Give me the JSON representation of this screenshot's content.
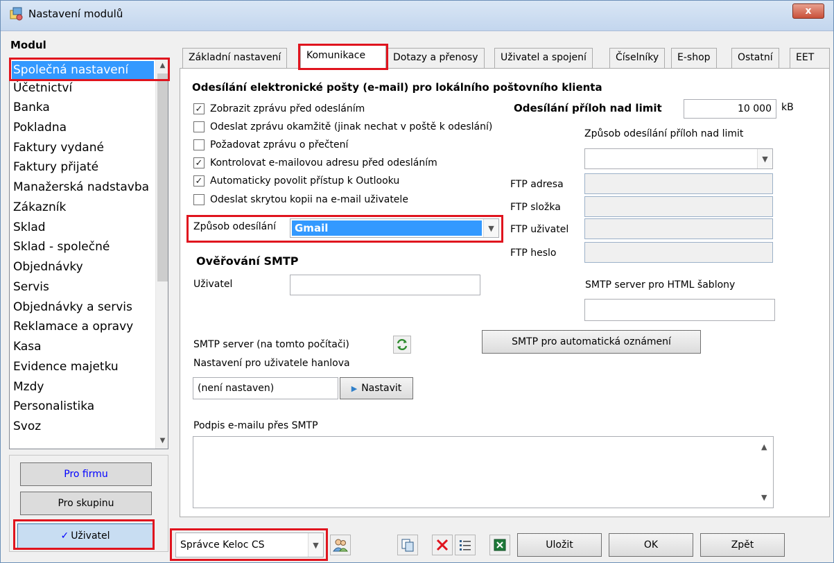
{
  "window": {
    "title": "Nastavení modulů",
    "close_label": "x"
  },
  "modules": {
    "header": "Modul",
    "items": [
      "Společná nastavení",
      "Účetnictví",
      "Banka",
      "Pokladna",
      "Faktury vydané",
      "Faktury přijaté",
      "Manažerská nadstavba",
      "Zákazník",
      "Sklad",
      "Sklad - společné",
      "Objednávky",
      "Servis",
      "Objednávky a servis",
      "Reklamace a opravy",
      "Kasa",
      "Evidence majetku",
      "Mzdy",
      "Personalistika",
      "Svoz"
    ],
    "selected_index": 0
  },
  "scope_buttons": {
    "company": "Pro firmu",
    "group": "Pro skupinu",
    "user": "Uživatel",
    "user_check": "✓"
  },
  "tabs": [
    "Základní nastavení",
    "Komunikace",
    "Dotazy a přenosy",
    "Uživatel a spojení",
    "Číselníky",
    "E-shop",
    "Ostatní",
    "EET"
  ],
  "active_tab": 1,
  "email": {
    "section_title": "Odesílání elektronické pošty (e-mail) pro lokálního poštovního klienta",
    "options": [
      {
        "label": "Zobrazit zprávu před odesláním",
        "checked": true
      },
      {
        "label": "Odeslat zprávu okamžitě (jinak nechat v poště k odeslání)",
        "checked": false
      },
      {
        "label": "Požadovat zprávu o přečtení",
        "checked": false
      },
      {
        "label": "Kontrolovat e-mailovou adresu před odesláním",
        "checked": true
      },
      {
        "label": "Automaticky povolit přístup k Outlooku",
        "checked": true
      },
      {
        "label": "Odeslat skrytou kopii na e-mail uživatele",
        "checked": false
      }
    ],
    "send_method_label": "Způsob odesílání",
    "send_method_value": "Gmail",
    "attachment_limit_label": "Odesílání příloh nad limit",
    "attachment_limit_value": "10 000",
    "attachment_limit_unit": "kB",
    "attachment_mode_label": "Způsob odesílání příloh nad limit",
    "attachment_mode_value": "",
    "ftp_address_label": "FTP adresa",
    "ftp_folder_label": "FTP složka",
    "ftp_user_label": "FTP uživatel",
    "ftp_password_label": "FTP heslo"
  },
  "smtp": {
    "auth_title": "Ověřování SMTP",
    "user_label": "Uživatel",
    "user_value": "",
    "html_server_label": "SMTP server pro HTML šablony",
    "html_server_value": "",
    "auto_notify_button": "SMTP pro automatická oznámení",
    "server_label": "SMTP server (na tomto počítači)",
    "user_settings_label": "Nastavení pro uživatele  hanlova",
    "server_value": "(není nastaven)",
    "set_button": "Nastavit",
    "signature_label": "Podpis e-mailu přes SMTP",
    "signature_value": ""
  },
  "footer": {
    "user_combo_value": "Správce Keloc CS",
    "save_button": "Uložit",
    "ok_button": "OK",
    "back_button": "Zpět"
  },
  "colors": {
    "selection": "#3399ff",
    "highlight": "#e0141e",
    "link_blue": "#0000ff"
  }
}
